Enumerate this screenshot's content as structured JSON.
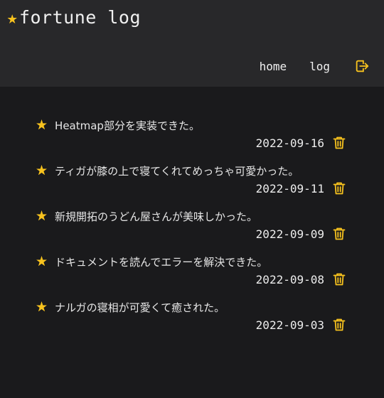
{
  "app": {
    "title": "fortune log",
    "accent": "#f7c21e",
    "background": "#1a1a1c",
    "header_background": "#28282a"
  },
  "nav": {
    "home_label": "home",
    "log_label": "log"
  },
  "entries": [
    {
      "text": "Heatmap部分を実装できた。",
      "date": "2022-09-16"
    },
    {
      "text": "ティガが膝の上で寝てくれてめっちゃ可愛かった。",
      "date": "2022-09-11"
    },
    {
      "text": "新規開拓のうどん屋さんが美味しかった。",
      "date": "2022-09-09"
    },
    {
      "text": "ドキュメントを読んでエラーを解決できた。",
      "date": "2022-09-08"
    },
    {
      "text": "ナルガの寝相が可愛くて癒された。",
      "date": "2022-09-03"
    }
  ]
}
